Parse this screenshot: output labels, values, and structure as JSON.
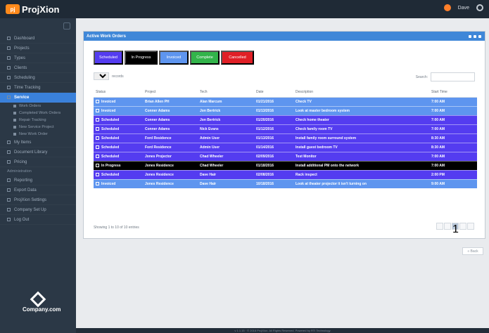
{
  "app": {
    "brand": "ProjXion",
    "brand_badge": "pj",
    "user": "Dave"
  },
  "colors": {
    "scheduled": "#543cf0",
    "in_progress": "#000000",
    "invoiced": "#5e95ef",
    "complete": "#32b44a",
    "cancelled": "#e01f26",
    "accent": "#3f87d8"
  },
  "sidebar": {
    "items": [
      "Dashboard",
      "Projects",
      "Types",
      "Clients",
      "Scheduling",
      "Time Tracking",
      "Service"
    ],
    "sub_items": [
      "Work Orders",
      "Completed Work Orders",
      "Repair Tracking",
      "New Service Project",
      "New Work Order"
    ],
    "items_after": [
      "My Items",
      "Document Library",
      "Pricing"
    ],
    "section": "Administration",
    "admin_items": [
      "Reporting",
      "Export Data",
      "ProjXion Settings",
      "Company Set Up",
      "Log Out"
    ],
    "company": "Company.com"
  },
  "panel": {
    "title": "Active Work Orders",
    "filters": [
      "Scheduled",
      "In Progress",
      "Invoiced",
      "Complete",
      "Cancelled"
    ],
    "records": "10",
    "records_label": "records",
    "search_label": "Search:",
    "info": "Showing 1 to 10 of 10 entries",
    "page": "1",
    "back_label": "« Back"
  },
  "table": {
    "headers": [
      "Status",
      "Project",
      "Tech",
      "Date",
      "Description",
      "Start Time"
    ],
    "rows": [
      [
        "Invoiced",
        "Brian Allen PH",
        "Alan Marcum",
        "01/21/2016",
        "Check TV",
        "7:00 AM"
      ],
      [
        "Invoiced",
        "Conner Adams",
        "Jon Bertrick",
        "01/13/2016",
        "Look at master bedroom system",
        "7:00 AM"
      ],
      [
        "Scheduled",
        "Conner Adams",
        "Jon Bertrick",
        "01/20/2016",
        "Check home theater",
        "7:00 AM"
      ],
      [
        "Scheduled",
        "Conner Adams",
        "Nick Evans",
        "01/12/2016",
        "Check family room TV",
        "7:00 AM"
      ],
      [
        "Scheduled",
        "Ford Residence",
        "Admin User",
        "01/13/2016",
        "Install family room surround system",
        "8:30 AM"
      ],
      [
        "Scheduled",
        "Ford Residence",
        "Admin User",
        "01/14/2016",
        "Install guest bedroom TV",
        "8:30 AM"
      ],
      [
        "Scheduled",
        "Jones Projector",
        "Chad Wheeler",
        "02/09/2016",
        "Test Monitor",
        "7:00 AM"
      ],
      [
        "In Progress",
        "Jones Residence",
        "Chad Wheeler",
        "01/18/2016",
        "Install additional PM onto the network",
        "7:00 AM"
      ],
      [
        "Scheduled",
        "Jones Residence",
        "Dave Hair",
        "02/08/2016",
        "Rack inspect",
        "2:00 PM"
      ],
      [
        "Invoiced",
        "Jones Residence",
        "Dave Hair",
        "10/18/2016",
        "Look at theater projector it isn't turning on",
        "9:00 AM"
      ]
    ]
  },
  "footer": "v 1.1.15 · © 2016 ProjXion. All Rights Reserved. Powered by RTI Technology"
}
